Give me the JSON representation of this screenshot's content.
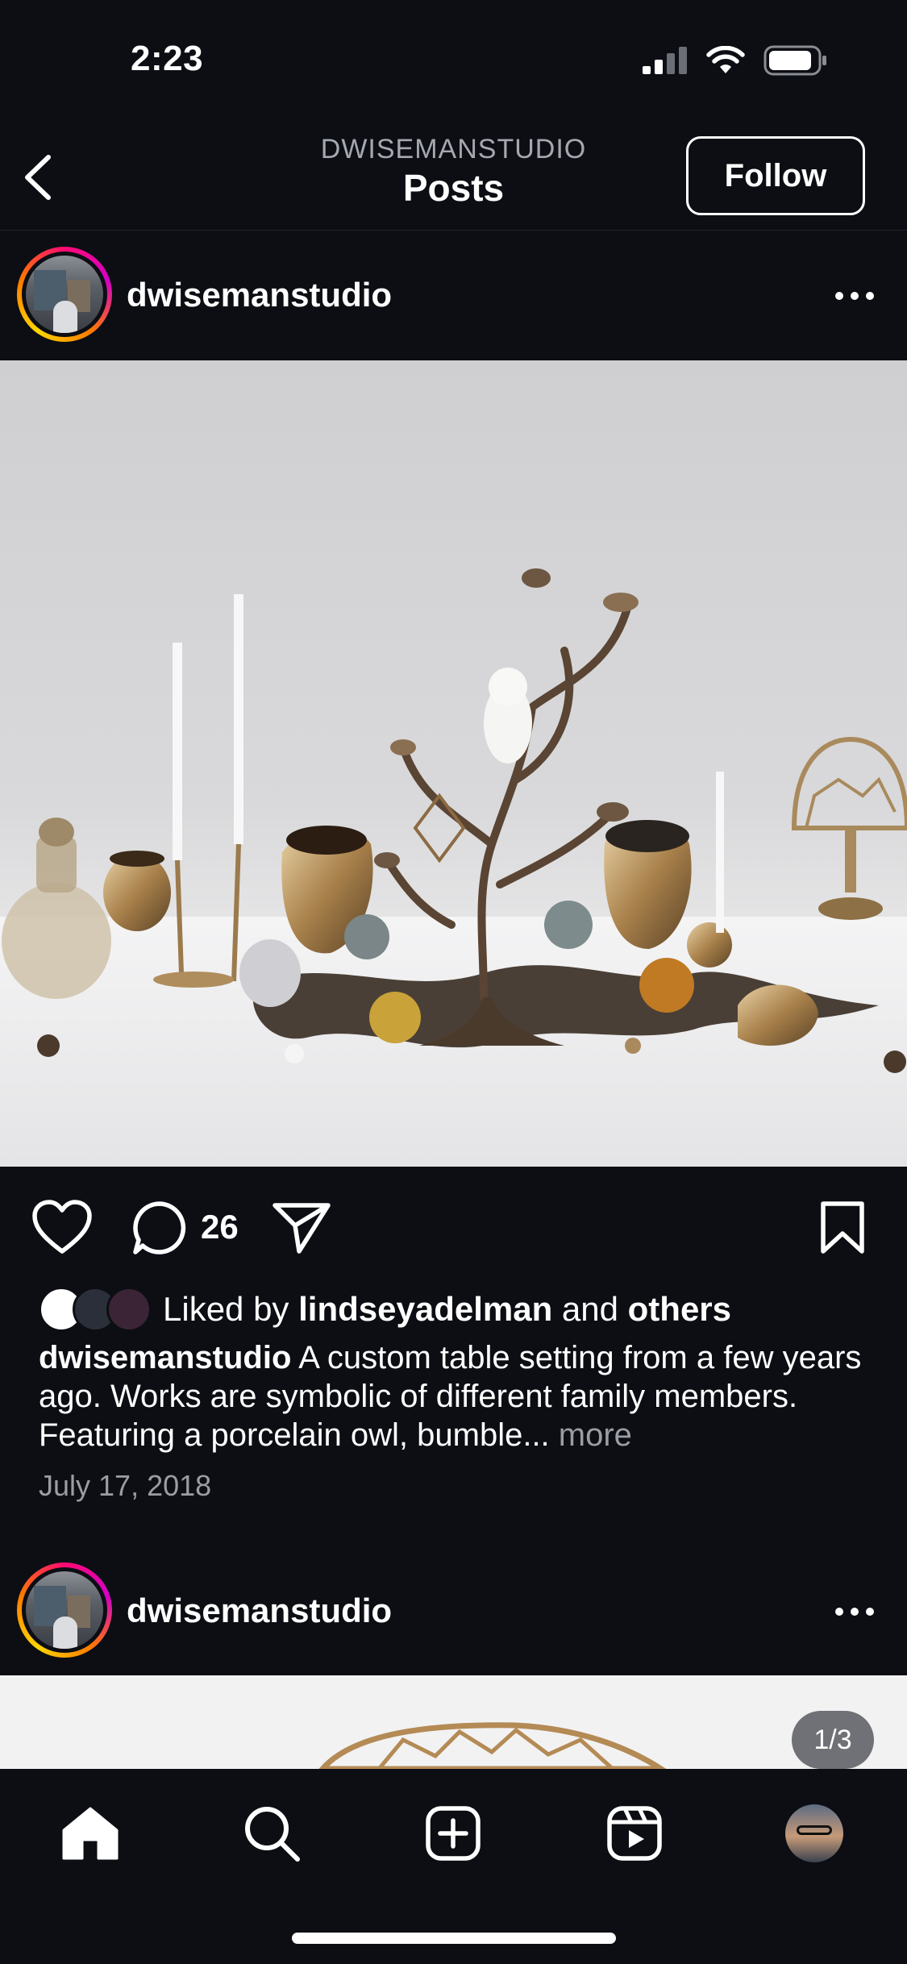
{
  "status_bar": {
    "time": "2:23"
  },
  "header": {
    "subtitle": "DWISEMANSTUDIO",
    "title": "Posts",
    "follow_label": "Follow"
  },
  "post": {
    "username": "dwisemanstudio",
    "comment_count": "26",
    "liked_prefix": "Liked by",
    "liked_user": "lindseyadelman",
    "liked_and": "and",
    "liked_others": "others",
    "caption_user": "dwisemanstudio",
    "caption_text": "A custom table setting from a few years ago. Works are symbolic of different family members. Featuring a porcelain owl, bumble...",
    "caption_more": "more",
    "date": "July 17, 2018"
  },
  "next_post": {
    "username": "dwisemanstudio",
    "carousel_counter": "1/3"
  },
  "bottom_nav": [
    "home-icon",
    "search-icon",
    "create-icon",
    "reels-icon",
    "profile-avatar"
  ],
  "colors": {
    "background": "#0c0e14",
    "text": "#ffffff",
    "muted": "#9a9da4"
  }
}
